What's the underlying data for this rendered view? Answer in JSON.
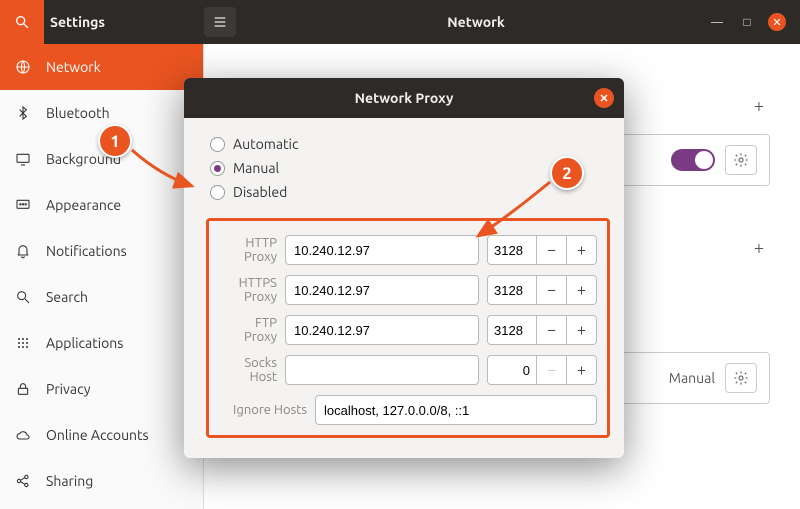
{
  "titlebar": {
    "app_title": "Settings",
    "page_title": "Network"
  },
  "sidebar": {
    "items": [
      {
        "label": "Network",
        "icon": "globe-icon"
      },
      {
        "label": "Bluetooth",
        "icon": "bluetooth-icon"
      },
      {
        "label": "Background",
        "icon": "background-icon"
      },
      {
        "label": "Appearance",
        "icon": "appearance-icon"
      },
      {
        "label": "Notifications",
        "icon": "bell-icon"
      },
      {
        "label": "Search",
        "icon": "search-icon"
      },
      {
        "label": "Applications",
        "icon": "grid-icon"
      },
      {
        "label": "Privacy",
        "icon": "lock-icon"
      },
      {
        "label": "Online Accounts",
        "icon": "cloud-icon"
      },
      {
        "label": "Sharing",
        "icon": "share-icon"
      }
    ]
  },
  "content": {
    "proxy_mode_label": "Manual"
  },
  "dialog": {
    "title": "Network Proxy",
    "radios": {
      "automatic": "Automatic",
      "manual": "Manual",
      "disabled": "Disabled",
      "selected": "manual"
    },
    "fields": {
      "http": {
        "label": "HTTP Proxy",
        "host": "10.240.12.97",
        "port": "3128"
      },
      "https": {
        "label": "HTTPS Proxy",
        "host": "10.240.12.97",
        "port": "3128"
      },
      "ftp": {
        "label": "FTP Proxy",
        "host": "10.240.12.97",
        "port": "3128"
      },
      "socks": {
        "label": "Socks Host",
        "host": "",
        "port": "0"
      },
      "ignore": {
        "label": "Ignore Hosts",
        "value": "localhost, 127.0.0.0/8, ::1"
      }
    }
  },
  "annotations": {
    "marker1": "1",
    "marker2": "2"
  },
  "colors": {
    "accent": "#e95420",
    "toggle": "#7a3a84"
  }
}
